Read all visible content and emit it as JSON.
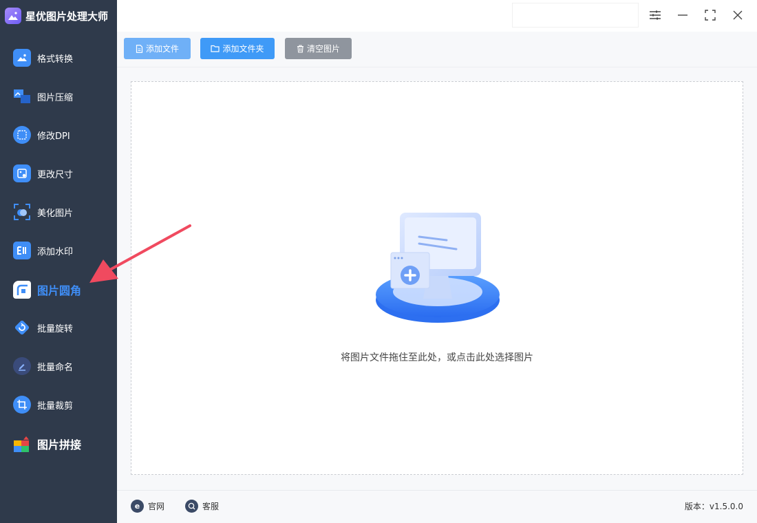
{
  "app": {
    "title": "星优图片处理大师"
  },
  "sidebar": {
    "items": [
      {
        "label": "格式转换",
        "icon": "format-convert-icon",
        "color": "#3f8ef7"
      },
      {
        "label": "图片压缩",
        "icon": "image-compress-icon",
        "color": "#3f8ef7"
      },
      {
        "label": "修改DPI",
        "icon": "dpi-icon",
        "color": "#3f8ef7"
      },
      {
        "label": "更改尺寸",
        "icon": "resize-icon",
        "color": "#3f8ef7"
      },
      {
        "label": "美化图片",
        "icon": "beautify-icon",
        "color": "#3f8ef7"
      },
      {
        "label": "添加水印",
        "icon": "watermark-icon",
        "color": "#3f8ef7"
      },
      {
        "label": "图片圆角",
        "icon": "round-corner-icon",
        "color": "#3f8ef7",
        "active": true
      },
      {
        "label": "批量旋转",
        "icon": "rotate-icon",
        "color": "#3f8ef7"
      },
      {
        "label": "批量命名",
        "icon": "rename-icon",
        "color": "#3f8ef7"
      },
      {
        "label": "批量裁剪",
        "icon": "crop-icon",
        "color": "#3f8ef7"
      },
      {
        "label": "图片拼接",
        "icon": "puzzle-icon",
        "color": "#f7b500"
      }
    ]
  },
  "toolbar": {
    "add_file": "添加文件",
    "add_folder": "添加文件夹",
    "clear_images": "清空图片"
  },
  "dropzone": {
    "hint": "将图片文件拖住至此处，或点击此处选择图片"
  },
  "footer": {
    "website": "官网",
    "support": "客服",
    "version": "版本：v1.5.0.0"
  },
  "colors": {
    "sidebar_bg": "#2f3a4b",
    "accent": "#3f8ef7",
    "btn_light": "#6fb0f7",
    "btn_primary": "#3f9af7",
    "btn_gray": "#8f959e",
    "annotation_arrow": "#f04a5f"
  }
}
